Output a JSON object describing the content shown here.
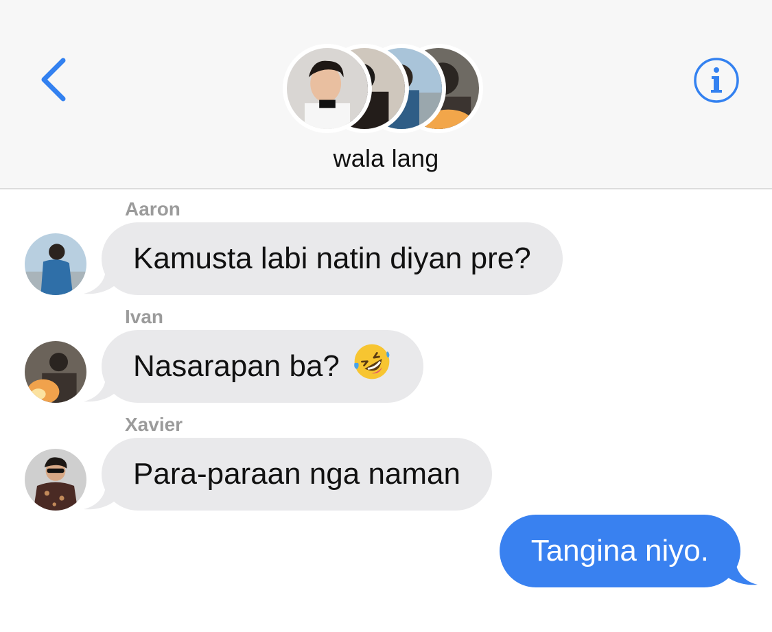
{
  "header": {
    "group_name": "wala lang",
    "back_icon": "chevron-left-icon",
    "info_icon": "info-circle-icon",
    "accent_color": "#3381f0"
  },
  "messages": [
    {
      "sender": "Aaron",
      "text": "Kamusta labi natin diyan pre?",
      "direction": "received"
    },
    {
      "sender": "Ivan",
      "text": "Nasarapan ba?",
      "emoji": "rolling-on-floor-laughing-emoji",
      "direction": "received"
    },
    {
      "sender": "Xavier",
      "text": "Para-paraan nga naman",
      "direction": "received"
    },
    {
      "text": "Tangina niyo.",
      "direction": "sent"
    }
  ],
  "colors": {
    "received_bubble": "#e9e9eb",
    "sent_bubble": "#3981f0",
    "sender_name": "#9b9b9b"
  }
}
